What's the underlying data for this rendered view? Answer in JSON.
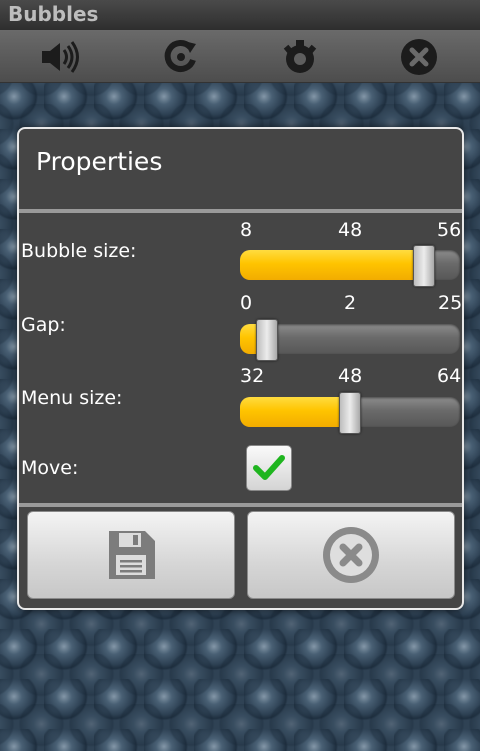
{
  "app": {
    "title": "Bubbles"
  },
  "toolbar": {
    "icons": [
      "speaker-icon",
      "restart-icon",
      "settings-icon",
      "close-icon"
    ]
  },
  "dialog": {
    "title": "Properties",
    "bubble_size": {
      "label": "Bubble size:",
      "min": "8",
      "value": "48",
      "max": "56",
      "fraction": 0.875
    },
    "gap": {
      "label": "Gap:",
      "min": "0",
      "value": "2",
      "max": "25",
      "fraction": 0.08
    },
    "menu_size": {
      "label": "Menu size:",
      "min": "32",
      "value": "48",
      "max": "64",
      "fraction": 0.5
    },
    "move": {
      "label": "Move:",
      "checked": true
    },
    "buttons": {
      "save": "save-icon",
      "cancel": "cancel-icon"
    }
  },
  "colors": {
    "accent": "#ffc400",
    "check": "#2ec32e",
    "dialog_bg": "#454545"
  }
}
